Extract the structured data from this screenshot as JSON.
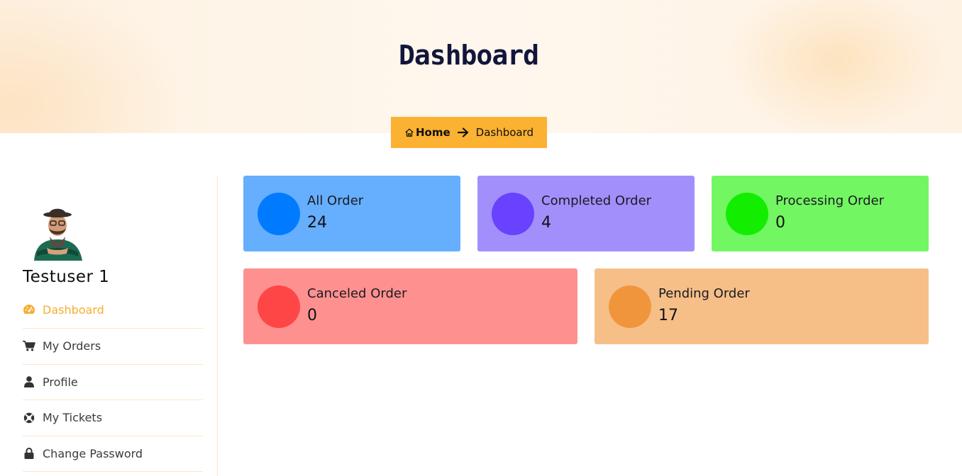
{
  "header": {
    "title": "Dashboard",
    "breadcrumb": {
      "home": "Home",
      "current": "Dashboard"
    }
  },
  "user": {
    "name": "Testuser 1"
  },
  "menu": [
    {
      "label": "Dashboard",
      "icon": "gauge-icon",
      "active": true
    },
    {
      "label": "My Orders",
      "icon": "cart-icon"
    },
    {
      "label": "Profile",
      "icon": "user-icon"
    },
    {
      "label": "My Tickets",
      "icon": "lifebuoy-icon"
    },
    {
      "label": "Change Password",
      "icon": "lock-icon"
    }
  ],
  "stats": [
    {
      "label": "All Order",
      "value": "24",
      "bg": "#66aefe",
      "dot": "#007bff"
    },
    {
      "label": "Completed Order",
      "value": "4",
      "bg": "#a28ffb",
      "dot": "#6842fe"
    },
    {
      "label": "Processing Order",
      "value": "0",
      "bg": "#72f662",
      "dot": "#12ed00"
    },
    {
      "label": "Canceled Order",
      "value": "0",
      "bg": "#fe9190",
      "dot": "#fe4646"
    },
    {
      "label": "Pending Order",
      "value": "17",
      "bg": "#f6bf88",
      "dot": "#f1953d"
    }
  ],
  "colors": {
    "accent": "#fbb131",
    "active_menu": "#f6ad2f"
  }
}
